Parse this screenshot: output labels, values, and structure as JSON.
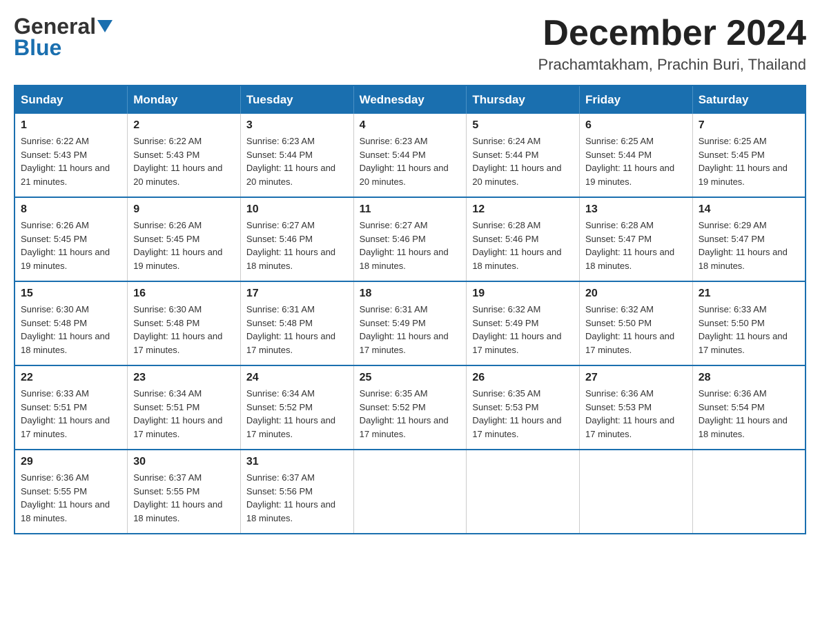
{
  "header": {
    "logo_general": "General",
    "logo_blue": "Blue",
    "month_title": "December 2024",
    "location": "Prachamtakham, Prachin Buri, Thailand"
  },
  "days_of_week": [
    "Sunday",
    "Monday",
    "Tuesday",
    "Wednesday",
    "Thursday",
    "Friday",
    "Saturday"
  ],
  "weeks": [
    [
      {
        "day": "1",
        "sunrise": "6:22 AM",
        "sunset": "5:43 PM",
        "daylight": "11 hours and 21 minutes."
      },
      {
        "day": "2",
        "sunrise": "6:22 AM",
        "sunset": "5:43 PM",
        "daylight": "11 hours and 20 minutes."
      },
      {
        "day": "3",
        "sunrise": "6:23 AM",
        "sunset": "5:44 PM",
        "daylight": "11 hours and 20 minutes."
      },
      {
        "day": "4",
        "sunrise": "6:23 AM",
        "sunset": "5:44 PM",
        "daylight": "11 hours and 20 minutes."
      },
      {
        "day": "5",
        "sunrise": "6:24 AM",
        "sunset": "5:44 PM",
        "daylight": "11 hours and 20 minutes."
      },
      {
        "day": "6",
        "sunrise": "6:25 AM",
        "sunset": "5:44 PM",
        "daylight": "11 hours and 19 minutes."
      },
      {
        "day": "7",
        "sunrise": "6:25 AM",
        "sunset": "5:45 PM",
        "daylight": "11 hours and 19 minutes."
      }
    ],
    [
      {
        "day": "8",
        "sunrise": "6:26 AM",
        "sunset": "5:45 PM",
        "daylight": "11 hours and 19 minutes."
      },
      {
        "day": "9",
        "sunrise": "6:26 AM",
        "sunset": "5:45 PM",
        "daylight": "11 hours and 19 minutes."
      },
      {
        "day": "10",
        "sunrise": "6:27 AM",
        "sunset": "5:46 PM",
        "daylight": "11 hours and 18 minutes."
      },
      {
        "day": "11",
        "sunrise": "6:27 AM",
        "sunset": "5:46 PM",
        "daylight": "11 hours and 18 minutes."
      },
      {
        "day": "12",
        "sunrise": "6:28 AM",
        "sunset": "5:46 PM",
        "daylight": "11 hours and 18 minutes."
      },
      {
        "day": "13",
        "sunrise": "6:28 AM",
        "sunset": "5:47 PM",
        "daylight": "11 hours and 18 minutes."
      },
      {
        "day": "14",
        "sunrise": "6:29 AM",
        "sunset": "5:47 PM",
        "daylight": "11 hours and 18 minutes."
      }
    ],
    [
      {
        "day": "15",
        "sunrise": "6:30 AM",
        "sunset": "5:48 PM",
        "daylight": "11 hours and 18 minutes."
      },
      {
        "day": "16",
        "sunrise": "6:30 AM",
        "sunset": "5:48 PM",
        "daylight": "11 hours and 17 minutes."
      },
      {
        "day": "17",
        "sunrise": "6:31 AM",
        "sunset": "5:48 PM",
        "daylight": "11 hours and 17 minutes."
      },
      {
        "day": "18",
        "sunrise": "6:31 AM",
        "sunset": "5:49 PM",
        "daylight": "11 hours and 17 minutes."
      },
      {
        "day": "19",
        "sunrise": "6:32 AM",
        "sunset": "5:49 PM",
        "daylight": "11 hours and 17 minutes."
      },
      {
        "day": "20",
        "sunrise": "6:32 AM",
        "sunset": "5:50 PM",
        "daylight": "11 hours and 17 minutes."
      },
      {
        "day": "21",
        "sunrise": "6:33 AM",
        "sunset": "5:50 PM",
        "daylight": "11 hours and 17 minutes."
      }
    ],
    [
      {
        "day": "22",
        "sunrise": "6:33 AM",
        "sunset": "5:51 PM",
        "daylight": "11 hours and 17 minutes."
      },
      {
        "day": "23",
        "sunrise": "6:34 AM",
        "sunset": "5:51 PM",
        "daylight": "11 hours and 17 minutes."
      },
      {
        "day": "24",
        "sunrise": "6:34 AM",
        "sunset": "5:52 PM",
        "daylight": "11 hours and 17 minutes."
      },
      {
        "day": "25",
        "sunrise": "6:35 AM",
        "sunset": "5:52 PM",
        "daylight": "11 hours and 17 minutes."
      },
      {
        "day": "26",
        "sunrise": "6:35 AM",
        "sunset": "5:53 PM",
        "daylight": "11 hours and 17 minutes."
      },
      {
        "day": "27",
        "sunrise": "6:36 AM",
        "sunset": "5:53 PM",
        "daylight": "11 hours and 17 minutes."
      },
      {
        "day": "28",
        "sunrise": "6:36 AM",
        "sunset": "5:54 PM",
        "daylight": "11 hours and 18 minutes."
      }
    ],
    [
      {
        "day": "29",
        "sunrise": "6:36 AM",
        "sunset": "5:55 PM",
        "daylight": "11 hours and 18 minutes."
      },
      {
        "day": "30",
        "sunrise": "6:37 AM",
        "sunset": "5:55 PM",
        "daylight": "11 hours and 18 minutes."
      },
      {
        "day": "31",
        "sunrise": "6:37 AM",
        "sunset": "5:56 PM",
        "daylight": "11 hours and 18 minutes."
      },
      {
        "day": "",
        "sunrise": "",
        "sunset": "",
        "daylight": ""
      },
      {
        "day": "",
        "sunrise": "",
        "sunset": "",
        "daylight": ""
      },
      {
        "day": "",
        "sunrise": "",
        "sunset": "",
        "daylight": ""
      },
      {
        "day": "",
        "sunrise": "",
        "sunset": "",
        "daylight": ""
      }
    ]
  ]
}
